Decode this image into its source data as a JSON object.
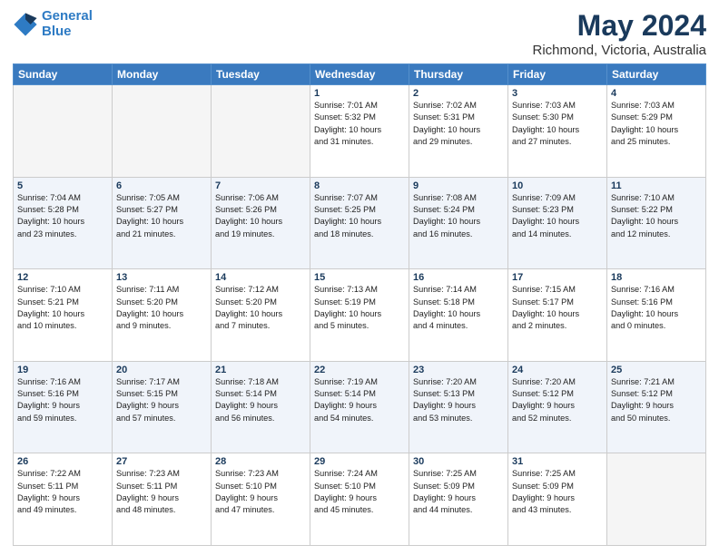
{
  "logo": {
    "line1": "General",
    "line2": "Blue"
  },
  "title": "May 2024",
  "subtitle": "Richmond, Victoria, Australia",
  "days_of_week": [
    "Sunday",
    "Monday",
    "Tuesday",
    "Wednesday",
    "Thursday",
    "Friday",
    "Saturday"
  ],
  "weeks": [
    [
      {
        "day": "",
        "info": ""
      },
      {
        "day": "",
        "info": ""
      },
      {
        "day": "",
        "info": ""
      },
      {
        "day": "1",
        "info": "Sunrise: 7:01 AM\nSunset: 5:32 PM\nDaylight: 10 hours\nand 31 minutes."
      },
      {
        "day": "2",
        "info": "Sunrise: 7:02 AM\nSunset: 5:31 PM\nDaylight: 10 hours\nand 29 minutes."
      },
      {
        "day": "3",
        "info": "Sunrise: 7:03 AM\nSunset: 5:30 PM\nDaylight: 10 hours\nand 27 minutes."
      },
      {
        "day": "4",
        "info": "Sunrise: 7:03 AM\nSunset: 5:29 PM\nDaylight: 10 hours\nand 25 minutes."
      }
    ],
    [
      {
        "day": "5",
        "info": "Sunrise: 7:04 AM\nSunset: 5:28 PM\nDaylight: 10 hours\nand 23 minutes."
      },
      {
        "day": "6",
        "info": "Sunrise: 7:05 AM\nSunset: 5:27 PM\nDaylight: 10 hours\nand 21 minutes."
      },
      {
        "day": "7",
        "info": "Sunrise: 7:06 AM\nSunset: 5:26 PM\nDaylight: 10 hours\nand 19 minutes."
      },
      {
        "day": "8",
        "info": "Sunrise: 7:07 AM\nSunset: 5:25 PM\nDaylight: 10 hours\nand 18 minutes."
      },
      {
        "day": "9",
        "info": "Sunrise: 7:08 AM\nSunset: 5:24 PM\nDaylight: 10 hours\nand 16 minutes."
      },
      {
        "day": "10",
        "info": "Sunrise: 7:09 AM\nSunset: 5:23 PM\nDaylight: 10 hours\nand 14 minutes."
      },
      {
        "day": "11",
        "info": "Sunrise: 7:10 AM\nSunset: 5:22 PM\nDaylight: 10 hours\nand 12 minutes."
      }
    ],
    [
      {
        "day": "12",
        "info": "Sunrise: 7:10 AM\nSunset: 5:21 PM\nDaylight: 10 hours\nand 10 minutes."
      },
      {
        "day": "13",
        "info": "Sunrise: 7:11 AM\nSunset: 5:20 PM\nDaylight: 10 hours\nand 9 minutes."
      },
      {
        "day": "14",
        "info": "Sunrise: 7:12 AM\nSunset: 5:20 PM\nDaylight: 10 hours\nand 7 minutes."
      },
      {
        "day": "15",
        "info": "Sunrise: 7:13 AM\nSunset: 5:19 PM\nDaylight: 10 hours\nand 5 minutes."
      },
      {
        "day": "16",
        "info": "Sunrise: 7:14 AM\nSunset: 5:18 PM\nDaylight: 10 hours\nand 4 minutes."
      },
      {
        "day": "17",
        "info": "Sunrise: 7:15 AM\nSunset: 5:17 PM\nDaylight: 10 hours\nand 2 minutes."
      },
      {
        "day": "18",
        "info": "Sunrise: 7:16 AM\nSunset: 5:16 PM\nDaylight: 10 hours\nand 0 minutes."
      }
    ],
    [
      {
        "day": "19",
        "info": "Sunrise: 7:16 AM\nSunset: 5:16 PM\nDaylight: 9 hours\nand 59 minutes."
      },
      {
        "day": "20",
        "info": "Sunrise: 7:17 AM\nSunset: 5:15 PM\nDaylight: 9 hours\nand 57 minutes."
      },
      {
        "day": "21",
        "info": "Sunrise: 7:18 AM\nSunset: 5:14 PM\nDaylight: 9 hours\nand 56 minutes."
      },
      {
        "day": "22",
        "info": "Sunrise: 7:19 AM\nSunset: 5:14 PM\nDaylight: 9 hours\nand 54 minutes."
      },
      {
        "day": "23",
        "info": "Sunrise: 7:20 AM\nSunset: 5:13 PM\nDaylight: 9 hours\nand 53 minutes."
      },
      {
        "day": "24",
        "info": "Sunrise: 7:20 AM\nSunset: 5:12 PM\nDaylight: 9 hours\nand 52 minutes."
      },
      {
        "day": "25",
        "info": "Sunrise: 7:21 AM\nSunset: 5:12 PM\nDaylight: 9 hours\nand 50 minutes."
      }
    ],
    [
      {
        "day": "26",
        "info": "Sunrise: 7:22 AM\nSunset: 5:11 PM\nDaylight: 9 hours\nand 49 minutes."
      },
      {
        "day": "27",
        "info": "Sunrise: 7:23 AM\nSunset: 5:11 PM\nDaylight: 9 hours\nand 48 minutes."
      },
      {
        "day": "28",
        "info": "Sunrise: 7:23 AM\nSunset: 5:10 PM\nDaylight: 9 hours\nand 47 minutes."
      },
      {
        "day": "29",
        "info": "Sunrise: 7:24 AM\nSunset: 5:10 PM\nDaylight: 9 hours\nand 45 minutes."
      },
      {
        "day": "30",
        "info": "Sunrise: 7:25 AM\nSunset: 5:09 PM\nDaylight: 9 hours\nand 44 minutes."
      },
      {
        "day": "31",
        "info": "Sunrise: 7:25 AM\nSunset: 5:09 PM\nDaylight: 9 hours\nand 43 minutes."
      },
      {
        "day": "",
        "info": ""
      }
    ]
  ]
}
